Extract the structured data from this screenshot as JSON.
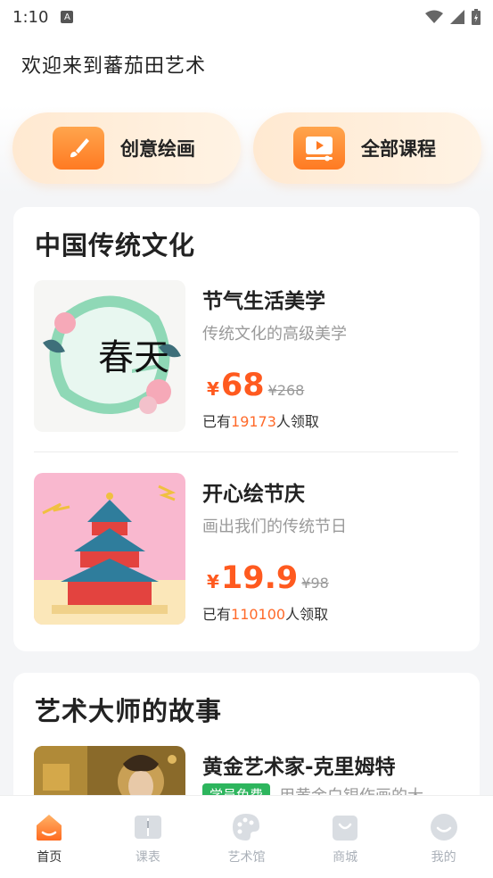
{
  "status_bar": {
    "time": "1:10"
  },
  "header": {
    "welcome": "欢迎来到蕃茄田艺术"
  },
  "quick_actions": [
    {
      "label": "创意绘画",
      "icon": "brush-icon"
    },
    {
      "label": "全部课程",
      "icon": "play-video-icon"
    }
  ],
  "sections": [
    {
      "title": "中国传统文化",
      "courses": [
        {
          "title": "节气生活美学",
          "subtitle": "传统文化的高级美学",
          "yen": "¥",
          "price": "68",
          "original_price": "¥268",
          "count_prefix": "已有",
          "count": "19173",
          "count_suffix": "人领取",
          "thumb_text": "春天"
        },
        {
          "title": "开心绘节庆",
          "subtitle": "画出我们的传统节日",
          "yen": "¥",
          "price": "19.9",
          "original_price": "¥98",
          "count_prefix": "已有",
          "count": "110100",
          "count_suffix": "人领取"
        }
      ]
    },
    {
      "title": "艺术大师的故事",
      "courses": [
        {
          "title": "黄金艺术家-克里姆特",
          "badge": "学员免费",
          "subtitle": "用黄金白银作画的大"
        }
      ]
    }
  ],
  "bottom_nav": [
    {
      "label": "首页",
      "icon": "home-icon",
      "active": true
    },
    {
      "label": "课表",
      "icon": "book-icon",
      "active": false
    },
    {
      "label": "艺术馆",
      "icon": "palette-icon",
      "active": false
    },
    {
      "label": "商城",
      "icon": "shop-bag-icon",
      "active": false
    },
    {
      "label": "我的",
      "icon": "smile-icon",
      "active": false
    }
  ],
  "colors": {
    "accent": "#ff5a1f",
    "badge_green": "#2db55d",
    "quick_bg": "#ffe9d1"
  }
}
